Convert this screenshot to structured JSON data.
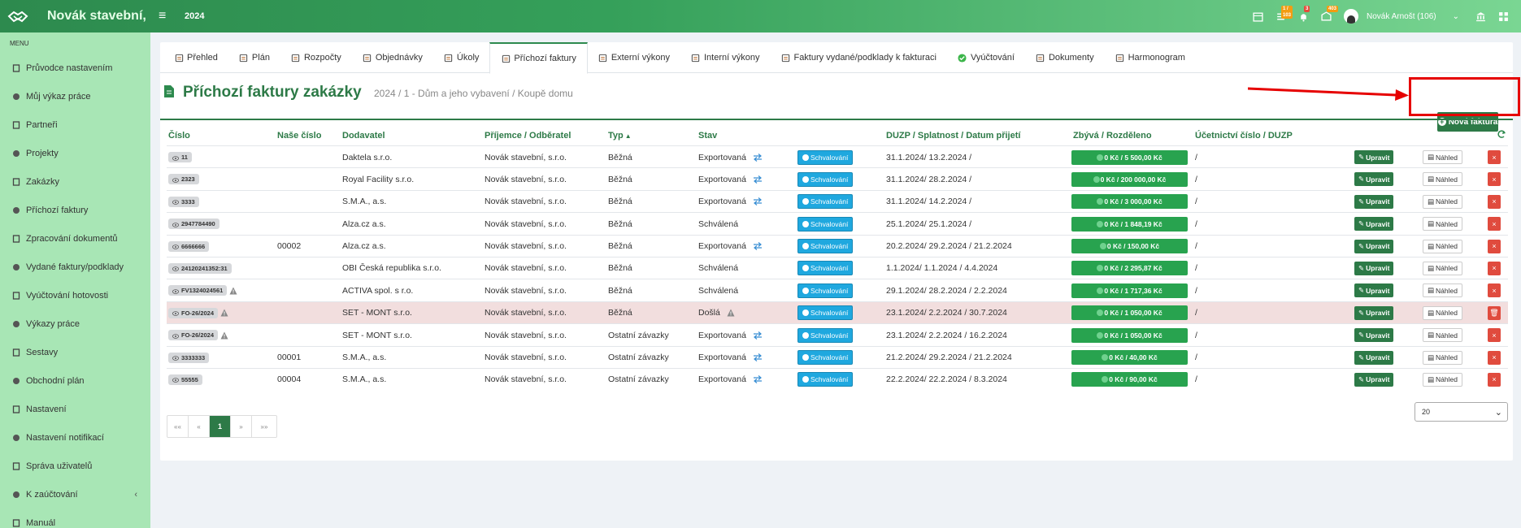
{
  "app": {
    "brand": "Novák stavební,",
    "year": "2024",
    "badges": {
      "tasks": "1 / 103",
      "notifications": "3",
      "messages": "403"
    },
    "user": "Novák Arnošt (106)"
  },
  "sidebar": {
    "menu_title": "MENU",
    "items": [
      {
        "label": "Průvodce nastavením",
        "icon": "wand-icon"
      },
      {
        "label": "Můj výkaz práce",
        "icon": "clock-icon"
      },
      {
        "label": "Partneři",
        "icon": "building-icon"
      },
      {
        "label": "Projekty",
        "icon": "sitemap-icon"
      },
      {
        "label": "Zakázky",
        "icon": "cube-icon"
      },
      {
        "label": "Příchozí faktury",
        "icon": "file-icon"
      },
      {
        "label": "Zpracování dokumentů",
        "icon": "file-text-icon"
      },
      {
        "label": "Vydané faktury/podklady",
        "icon": "file-export-icon"
      },
      {
        "label": "Vyúčtování hotovosti",
        "icon": "money-icon"
      },
      {
        "label": "Výkazy práce",
        "icon": "clock-icon"
      },
      {
        "label": "Sestavy",
        "icon": "list-icon"
      },
      {
        "label": "Obchodní plán",
        "icon": "rocket-icon"
      },
      {
        "label": "Nastavení",
        "icon": "cogs-icon"
      },
      {
        "label": "Nastavení notifikací",
        "icon": "bell-icon"
      },
      {
        "label": "Správa uživatelů",
        "icon": "users-icon"
      },
      {
        "label": "K zaúčtování",
        "icon": "folder-icon"
      },
      {
        "label": "Manuál",
        "icon": "book-icon"
      }
    ]
  },
  "tabs": [
    {
      "label": "Přehled",
      "icon": "cube-icon"
    },
    {
      "label": "Plán",
      "icon": "calendar-icon"
    },
    {
      "label": "Rozpočty",
      "icon": "budget-icon"
    },
    {
      "label": "Objednávky",
      "icon": "order-icon"
    },
    {
      "label": "Úkoly",
      "icon": "tasks-icon"
    },
    {
      "label": "Příchozí faktury",
      "icon": "invoice-in-icon"
    },
    {
      "label": "Externí výkony",
      "icon": "external-icon"
    },
    {
      "label": "Interní výkony",
      "icon": "internal-icon"
    },
    {
      "label": "Faktury vydané/podklady k fakturaci",
      "icon": "invoice-out-icon"
    },
    {
      "label": "Vyúčtování",
      "icon": "check-circle-icon"
    },
    {
      "label": "Dokumenty",
      "icon": "document-icon"
    },
    {
      "label": "Harmonogram",
      "icon": "calendar-icon"
    }
  ],
  "header": {
    "title": "Příchozí faktury zakázky",
    "subtitle": "2024 / 1 - Dům a jeho vybavení / Koupě domu",
    "new_button": "Nová faktura"
  },
  "table": {
    "columns": {
      "cislo": "Číslo",
      "nase_cislo": "Naše číslo",
      "dodavatel": "Dodavatel",
      "prijemce": "Příjemce / Odběratel",
      "typ": "Typ",
      "stav": "Stav",
      "duzp": "DUZP / Splatnost / Datum přijetí",
      "zbyva": "Zbývá / Rozděleno",
      "ucetni": "Účetnictví číslo / DUZP"
    },
    "labels": {
      "approve": "Schvalování",
      "edit": "Upravit",
      "view": "Náhled"
    },
    "rows": [
      {
        "cislo": "11",
        "nase": "",
        "dodavatel": "Daktela s.r.o.",
        "prijemce": "Novák stavební, s.r.o.",
        "typ": "Běžná",
        "stav": "Exportovaná",
        "export": true,
        "warn": false,
        "stav_warn": false,
        "dates": "31.1.2024/ 13.2.2024 /",
        "zbyva": "0 Kč / 5 500,00 Kč",
        "ucetni": "/",
        "highlight": false
      },
      {
        "cislo": "2323",
        "nase": "",
        "dodavatel": "Royal Facility s.r.o.",
        "prijemce": "Novák stavební, s.r.o.",
        "typ": "Běžná",
        "stav": "Exportovaná",
        "export": true,
        "warn": false,
        "stav_warn": false,
        "dates": "31.1.2024/ 28.2.2024 /",
        "zbyva": "0 Kč / 200 000,00 Kč",
        "ucetni": "/",
        "highlight": false
      },
      {
        "cislo": "3333",
        "nase": "",
        "dodavatel": "S.M.A., a.s.",
        "prijemce": "Novák stavební, s.r.o.",
        "typ": "Běžná",
        "stav": "Exportovaná",
        "export": true,
        "warn": false,
        "stav_warn": false,
        "dates": "31.1.2024/ 14.2.2024 /",
        "zbyva": "0 Kč / 3 000,00 Kč",
        "ucetni": "/",
        "highlight": false
      },
      {
        "cislo": "2947784490",
        "nase": "",
        "dodavatel": "Alza.cz a.s.",
        "prijemce": "Novák stavební, s.r.o.",
        "typ": "Běžná",
        "stav": "Schválená",
        "export": false,
        "warn": false,
        "stav_warn": false,
        "dates": "25.1.2024/ 25.1.2024 /",
        "zbyva": "0 Kč / 1 848,19 Kč",
        "ucetni": "/",
        "highlight": false
      },
      {
        "cislo": "6666666",
        "nase": "00002",
        "dodavatel": "Alza.cz a.s.",
        "prijemce": "Novák stavební, s.r.o.",
        "typ": "Běžná",
        "stav": "Exportovaná",
        "export": true,
        "warn": false,
        "stav_warn": false,
        "dates": "20.2.2024/ 29.2.2024 / 21.2.2024",
        "zbyva": "0 Kč / 150,00 Kč",
        "ucetni": "/",
        "highlight": false
      },
      {
        "cislo": "24120241352:31",
        "nase": "",
        "dodavatel": "OBI Česká republika s.r.o.",
        "prijemce": "Novák stavební, s.r.o.",
        "typ": "Běžná",
        "stav": "Schválená",
        "export": false,
        "warn": false,
        "stav_warn": false,
        "dates": "1.1.2024/ 1.1.2024 / 4.4.2024",
        "zbyva": "0 Kč / 2 295,87 Kč",
        "ucetni": "/",
        "highlight": false
      },
      {
        "cislo": "FV1324024561",
        "nase": "",
        "dodavatel": "ACTIVA spol. s r.o.",
        "prijemce": "Novák stavební, s.r.o.",
        "typ": "Běžná",
        "stav": "Schválená",
        "export": false,
        "warn": true,
        "stav_warn": false,
        "dates": "29.1.2024/ 28.2.2024 / 2.2.2024",
        "zbyva": "0 Kč / 1 717,36 Kč",
        "ucetni": "/",
        "highlight": false
      },
      {
        "cislo": "FO-26/2024",
        "nase": "",
        "dodavatel": "SET - MONT s.r.o.",
        "prijemce": "Novák stavební, s.r.o.",
        "typ": "Běžná",
        "stav": "Došlá",
        "export": false,
        "warn": true,
        "stav_warn": true,
        "dates": "23.1.2024/ 2.2.2024 / 30.7.2024",
        "zbyva": "0 Kč / 1 050,00 Kč",
        "ucetni": "/",
        "highlight": true
      },
      {
        "cislo": "FO-26/2024",
        "nase": "",
        "dodavatel": "SET - MONT s.r.o.",
        "prijemce": "Novák stavební, s.r.o.",
        "typ": "Ostatní závazky",
        "stav": "Exportovaná",
        "export": true,
        "warn": true,
        "stav_warn": false,
        "dates": "23.1.2024/ 2.2.2024 / 16.2.2024",
        "zbyva": "0 Kč / 1 050,00 Kč",
        "ucetni": "/",
        "highlight": false
      },
      {
        "cislo": "3333333",
        "nase": "00001",
        "dodavatel": "S.M.A., a.s.",
        "prijemce": "Novák stavební, s.r.o.",
        "typ": "Ostatní závazky",
        "stav": "Exportovaná",
        "export": true,
        "warn": false,
        "stav_warn": false,
        "dates": "21.2.2024/ 29.2.2024 / 21.2.2024",
        "zbyva": "0 Kč / 40,00 Kč",
        "ucetni": "/",
        "highlight": false
      },
      {
        "cislo": "55555",
        "nase": "00004",
        "dodavatel": "S.M.A., a.s.",
        "prijemce": "Novák stavební, s.r.o.",
        "typ": "Ostatní závazky",
        "stav": "Exportovaná",
        "export": true,
        "warn": false,
        "stav_warn": false,
        "dates": "22.2.2024/ 22.2.2024 / 8.3.2024",
        "zbyva": "0 Kč / 90,00 Kč",
        "ucetni": "/",
        "highlight": false
      }
    ]
  },
  "pagination": {
    "first": "««",
    "prev": "«",
    "current": "1",
    "next": "»",
    "last": "»»"
  },
  "per_page": "20",
  "colors": {
    "brand_green": "#2d7a47",
    "sidebar_bg": "#a8e6b5",
    "approve_blue": "#1fa8df",
    "highlight_row": "#f2dede",
    "annotation_red": "#e60000"
  }
}
